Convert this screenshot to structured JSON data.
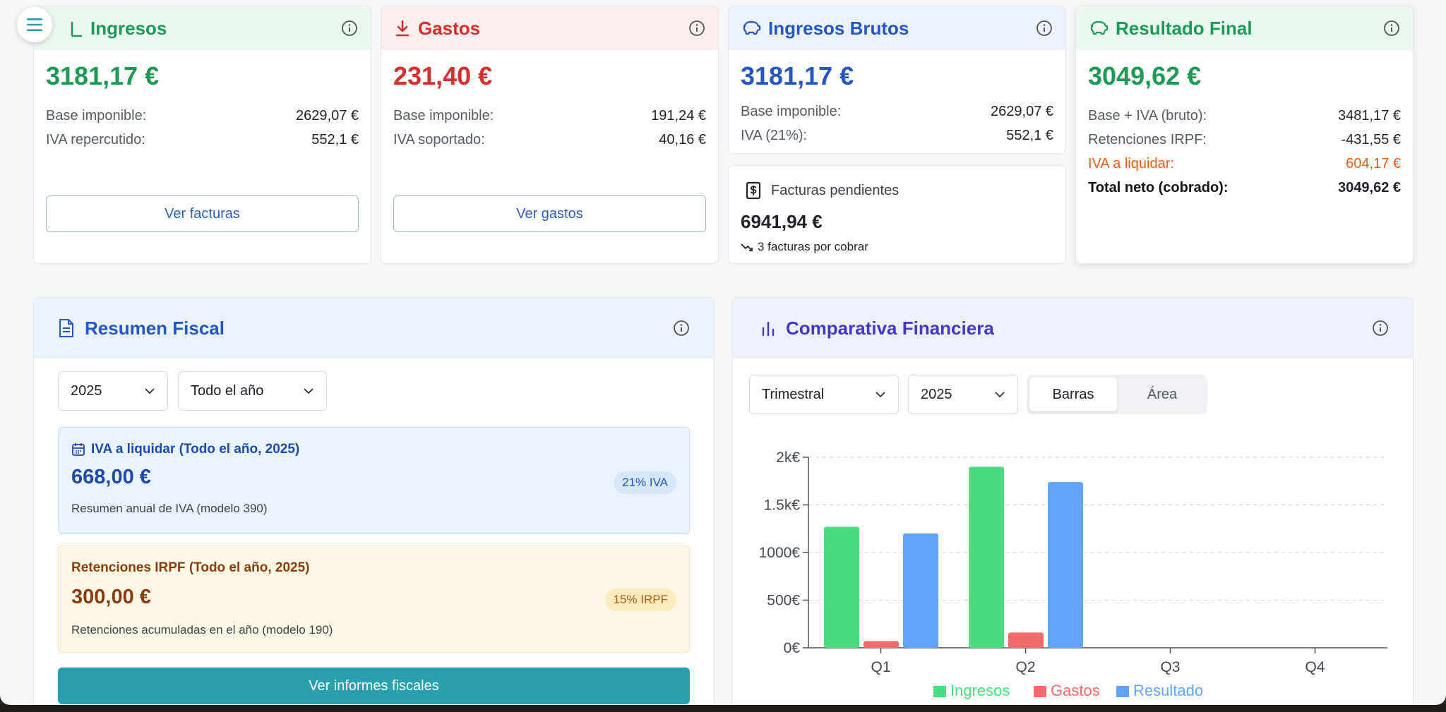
{
  "colors": {
    "green": "#1e9a57",
    "red": "#d62f2f",
    "blue": "#2456c6",
    "orange": "#e4601a",
    "indigo": "#4338ca",
    "teal": "#2a9fae"
  },
  "cards": {
    "ingresos": {
      "title": "Ingresos",
      "amount": "3181,17 €",
      "rows": [
        {
          "label": "Base imponible:",
          "value": "2629,07 €"
        },
        {
          "label": "IVA repercutido:",
          "value": "552,1 €"
        }
      ],
      "button": "Ver facturas"
    },
    "gastos": {
      "title": "Gastos",
      "amount": "231,40 €",
      "rows": [
        {
          "label": "Base imponible:",
          "value": "191,24 €"
        },
        {
          "label": "IVA soportado:",
          "value": "40,16 €"
        }
      ],
      "button": "Ver gastos"
    },
    "brutos": {
      "title": "Ingresos Brutos",
      "amount": "3181,17 €",
      "rows": [
        {
          "label": "Base imponible:",
          "value": "2629,07 €"
        },
        {
          "label": "IVA (21%):",
          "value": "552,1 €"
        }
      ]
    },
    "pendientes": {
      "title": "Facturas pendientes",
      "amount": "6941,94 €",
      "note": "3 facturas por cobrar"
    },
    "resultado": {
      "title": "Resultado Final",
      "amount": "3049,62 €",
      "rows": [
        {
          "label": "Base + IVA (bruto):",
          "value": "3481,17 €"
        },
        {
          "label": "Retenciones IRPF:",
          "value": "-431,55 €"
        },
        {
          "label": "IVA a liquidar:",
          "value": "604,17 €"
        },
        {
          "label": "Total neto (cobrado):",
          "value": "3049,62 €"
        }
      ]
    }
  },
  "resumen": {
    "title": "Resumen Fiscal",
    "year_select": "2025",
    "period_select": "Todo el año",
    "iva": {
      "title": "IVA a liquidar (Todo el año, 2025)",
      "amount": "668,00 €",
      "badge": "21% IVA",
      "desc": "Resumen anual de IVA (modelo 390)"
    },
    "irpf": {
      "title": "Retenciones IRPF (Todo el año, 2025)",
      "amount": "300,00 €",
      "badge": "15% IRPF",
      "desc": "Retenciones acumuladas en el año (modelo 190)"
    },
    "button": "Ver informes fiscales"
  },
  "comparativa": {
    "title": "Comparativa Financiera",
    "period_select": "Trimestral",
    "year_select": "2025",
    "toggle": [
      "Barras",
      "Área"
    ],
    "toggle_active": "Barras"
  },
  "chart_data": {
    "type": "bar",
    "categories": [
      "Q1",
      "Q2",
      "Q3",
      "Q4"
    ],
    "series": [
      {
        "name": "Ingresos",
        "color": "#4ade80",
        "values": [
          1270,
          1900,
          0,
          0
        ]
      },
      {
        "name": "Gastos",
        "color": "#f26b6b",
        "values": [
          70,
          160,
          0,
          0
        ]
      },
      {
        "name": "Resultado",
        "color": "#60a5fa",
        "values": [
          1200,
          1740,
          0,
          0
        ]
      }
    ],
    "yticks": [
      "0€",
      "500€",
      "1000€",
      "1.5k€",
      "2k€"
    ],
    "ylim": [
      0,
      2000
    ],
    "grid": true,
    "legend_position": "bottom"
  }
}
